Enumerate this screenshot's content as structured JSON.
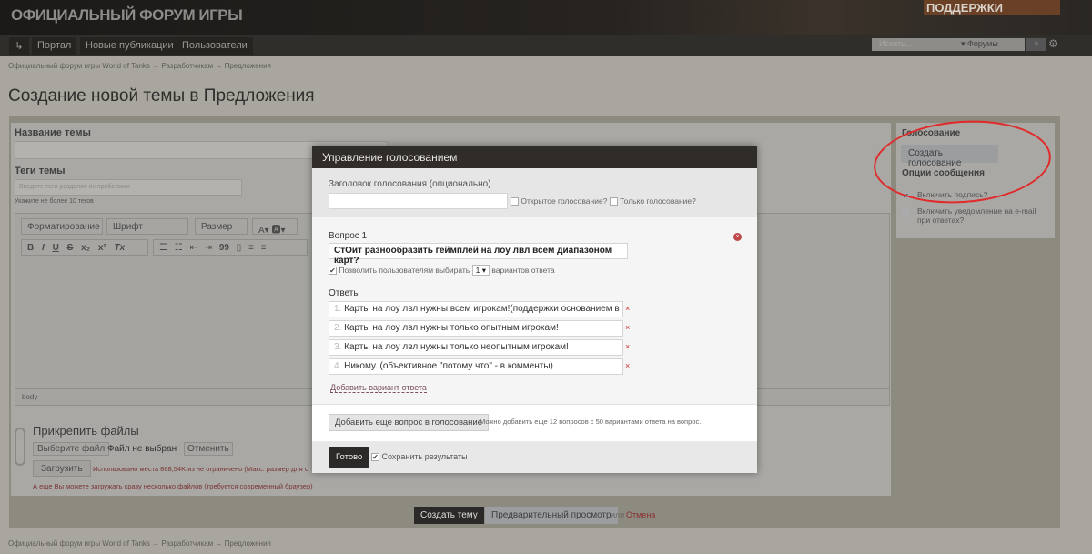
{
  "header": {
    "logo": "ОФИЦИАЛЬНЫЙ ФОРУМ ИГРЫ",
    "banner": "ПОДДЕРЖКИ"
  },
  "nav": {
    "items": [
      "Портал",
      "Новые публикации",
      "Пользователи"
    ],
    "search_placeholder": "Искать...",
    "search_scope": "Форумы"
  },
  "breadcrumb": [
    "Официальный форум игры World of Tanks",
    "Разработчикам",
    "Предложения"
  ],
  "page_title": "Создание новой темы в Предложения",
  "form": {
    "title_label": "Название темы",
    "tags_label": "Теги темы",
    "tags_placeholder": "Введите теги разделяя их пробелами",
    "tags_hint": "Укажите не более 10 тегов",
    "editor": {
      "format": "Форматирование",
      "font": "Шрифт",
      "size": "Размер",
      "bold": "B",
      "italic": "I",
      "underline": "U",
      "strike": "S",
      "sub": "x₂",
      "sup": "x²",
      "clear": "Tx",
      "quote": "99",
      "path": "body"
    },
    "attach": {
      "title": "Прикрепить файлы",
      "choose": "Выберите файл",
      "no_file": "Файл не выбран",
      "cancel": "Отменить",
      "upload": "Загрузить",
      "usage": "Использовано места 868,54K из не ограничено (Макс. размер для о",
      "multi": "А еще Вы можете загружать сразу несколько файлов (требуется современный браузер)"
    }
  },
  "sidebar": {
    "poll_title": "Голосование",
    "create_poll": "Создать голосование",
    "options_title": "Опции сообщения",
    "opt1": "Включить подпись?",
    "opt2": "Включить уведомление на e-mail при ответах?"
  },
  "modal": {
    "title": "Управление голосованием",
    "poll_title_label": "Заголовок голосования (опционально)",
    "poll_title_value": "",
    "open_poll": "Открытое голосование?",
    "vote_only": "Только голосование?",
    "question_label": "Вопрос 1",
    "question": "СтОит разнообразить геймплей на лоу лвл всем диапазоном карт?",
    "allow_label": "Позволить пользователям выбирать",
    "allow_count": "1",
    "allow_suffix": "вариантов ответа",
    "answers_label": "Ответы",
    "answers": [
      {
        "n": "1.",
        "t": "Карты на лоу лвл нужны всем игрокам!(поддержки основанием в теме)!"
      },
      {
        "n": "2.",
        "t": "Карты на лоу лвл нужны только опытным игрокам!"
      },
      {
        "n": "3.",
        "t": "Карты на лоу лвл нужны только неопытным игрокам!"
      },
      {
        "n": "4.",
        "t": "Никому. (объективное \"потому что\" - в комменты)"
      }
    ],
    "add_answer": "Добавить вариант ответа",
    "add_question": "Добавить еще вопрос в голосование",
    "add_hint": "Можно добавить еще 12 вопросов с 50 вариантами ответа на вопрос.",
    "done": "Готово",
    "save_results": "Сохранить результаты",
    "remove_x": "×"
  },
  "bottom": {
    "create": "Создать тему",
    "preview": "Предварительный просмотр",
    "or": "или",
    "cancel": "Отмена"
  }
}
